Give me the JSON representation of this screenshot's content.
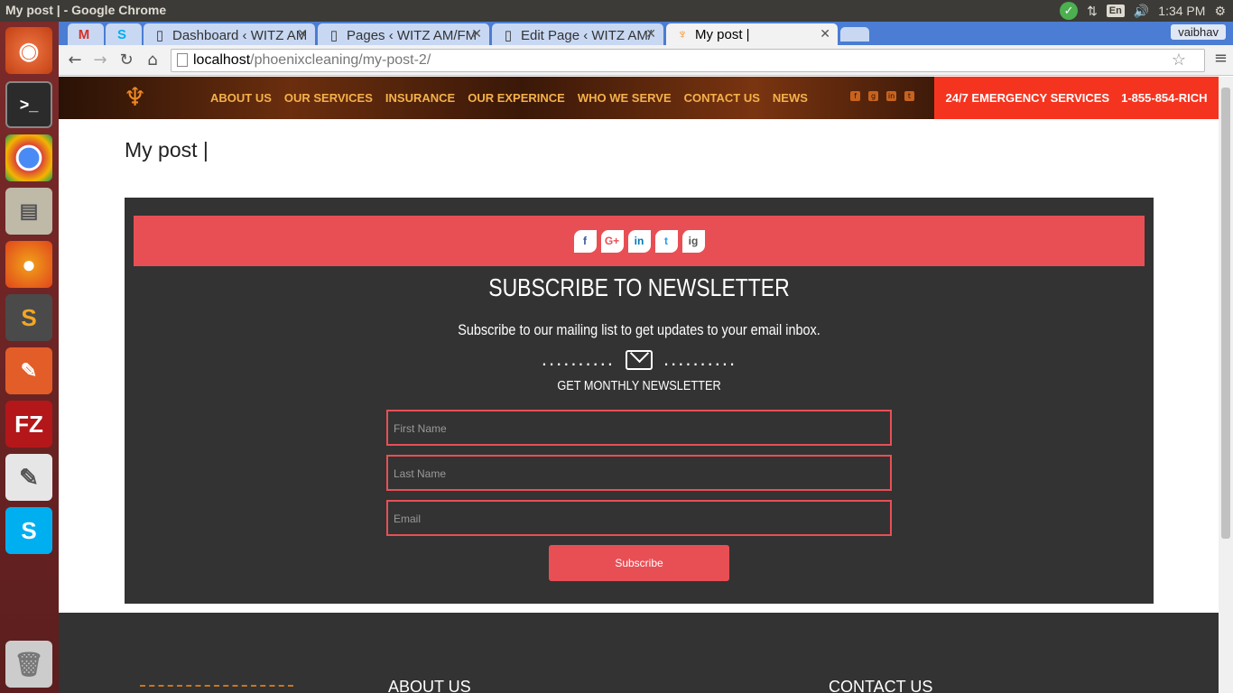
{
  "window_title": "My post | - Google Chrome",
  "clock": "1:34 PM",
  "lang": "En",
  "user": "vaibhav",
  "tabs": [
    {
      "label": "",
      "icon": "gmail"
    },
    {
      "label": "",
      "icon": "skype"
    },
    {
      "label": "Dashboard ‹ WITZ AM",
      "icon": "page"
    },
    {
      "label": "Pages ‹ WITZ AM/FM",
      "icon": "page"
    },
    {
      "label": "Edit Page ‹ WITZ AM/",
      "icon": "page"
    },
    {
      "label": "My post |",
      "icon": "phoenix"
    }
  ],
  "url": {
    "host": "localhost",
    "path": "/phoenixcleaning/my-post-2/"
  },
  "site": {
    "nav": [
      "ABOUT US",
      "OUR SERVICES",
      "INSURANCE",
      "OUR EXPERINCE",
      "WHO WE SERVE",
      "CONTACT US",
      "NEWS"
    ],
    "emergency": "24/7 EMERGENCY SERVICES",
    "phone": "1-855-854-RICH"
  },
  "page_title": "My post |",
  "newsletter": {
    "social": [
      "f",
      "G+",
      "in",
      "t",
      "ig"
    ],
    "heading": "SUBSCRIBE TO NEWSLETTER",
    "description": "Subscribe to our mailing list to get updates to your email inbox.",
    "dots": "..........",
    "subheading": "GET MONTHLY NEWSLETTER",
    "first_name": "First Name",
    "last_name": "Last Name",
    "email": "Email",
    "button": "Subscribe"
  },
  "footer": {
    "about": "ABOUT US",
    "contact": "CONTACT US"
  }
}
